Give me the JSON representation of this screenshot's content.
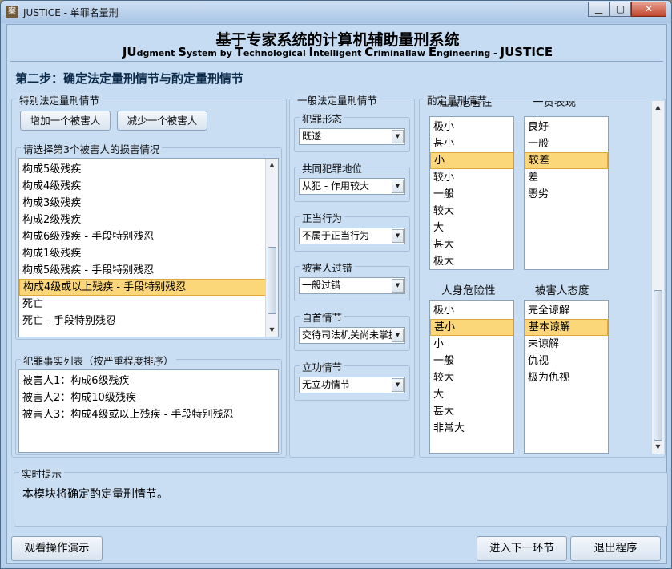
{
  "window": {
    "title": "JUSTICE - 单罪名量刑",
    "icon_glyph": "案",
    "controls": {
      "minimize": "▁",
      "maximize": "▢",
      "close": "✕"
    }
  },
  "header": {
    "title": "基于专家系统的计算机辅助量刑系统",
    "subtitle_parts": [
      "JU",
      "dgment ",
      "S",
      "ystem by ",
      "T",
      "echnological ",
      "I",
      "ntelligent ",
      "C",
      "riminallaw ",
      "E",
      "ngineering - ",
      "JUSTICE"
    ]
  },
  "step_title": "第二步：确定法定量刑情节与酌定量刑情节",
  "special": {
    "label": "特别法定量刑情节",
    "add_victim": "增加一个被害人",
    "remove_victim": "减少一个被害人",
    "injury_label": "请选择第3个被害人的损害情况",
    "injury_items": [
      "构成5级残疾",
      "构成4级残疾",
      "构成3级残疾",
      "构成2级残疾",
      "构成6级残疾 - 手段特别残忍",
      "构成1级残疾",
      "构成5级残疾 - 手段特别残忍",
      "构成4级或以上残疾 - 手段特别残忍",
      "死亡",
      "死亡 - 手段特别残忍"
    ],
    "injury_selected_index": 7,
    "facts_label": "犯罪事实列表（按严重程度排序）",
    "facts": [
      "被害人1：构成6级残疾",
      "被害人2：构成10级残疾",
      "被害人3：构成4级或以上残疾 - 手段特别残忍"
    ]
  },
  "general": {
    "label": "一般法定量刑情节",
    "fields": [
      {
        "label": "犯罪形态",
        "value": "既遂"
      },
      {
        "label": "共同犯罪地位",
        "value": "从犯 - 作用较大"
      },
      {
        "label": "正当行为",
        "value": "不属于正当行为"
      },
      {
        "label": "被害人过错",
        "value": "一般过错"
      },
      {
        "label": "自首情节",
        "value": "交待司法机关尚未掌握"
      },
      {
        "label": "立功情节",
        "value": "无立功情节"
      }
    ]
  },
  "discretionary": {
    "label": "酌定量刑情节",
    "top_headers": [
      "社会危害性",
      "一贯表现"
    ],
    "list1": [
      "极小",
      "甚小",
      "小",
      "较小",
      "一般",
      "较大",
      "大",
      "甚大",
      "极大"
    ],
    "list1_selected_index": 2,
    "list2": [
      "良好",
      "一般",
      "较差",
      "差",
      "恶劣"
    ],
    "list2_selected_index": 2,
    "header3": "人身危险性",
    "header4": "被害人态度",
    "list3": [
      "极小",
      "甚小",
      "小",
      "一般",
      "较大",
      "大",
      "甚大",
      "非常大"
    ],
    "list3_selected_index": 1,
    "list4": [
      "完全谅解",
      "基本谅解",
      "未谅解",
      "仇视",
      "极为仇视"
    ],
    "list4_selected_index": 1
  },
  "status": {
    "label": "实时提示",
    "message": "本模块将确定酌定量刑情节。"
  },
  "footer": {
    "demo": "观看操作演示",
    "next": "进入下一环节",
    "exit": "退出程序"
  }
}
